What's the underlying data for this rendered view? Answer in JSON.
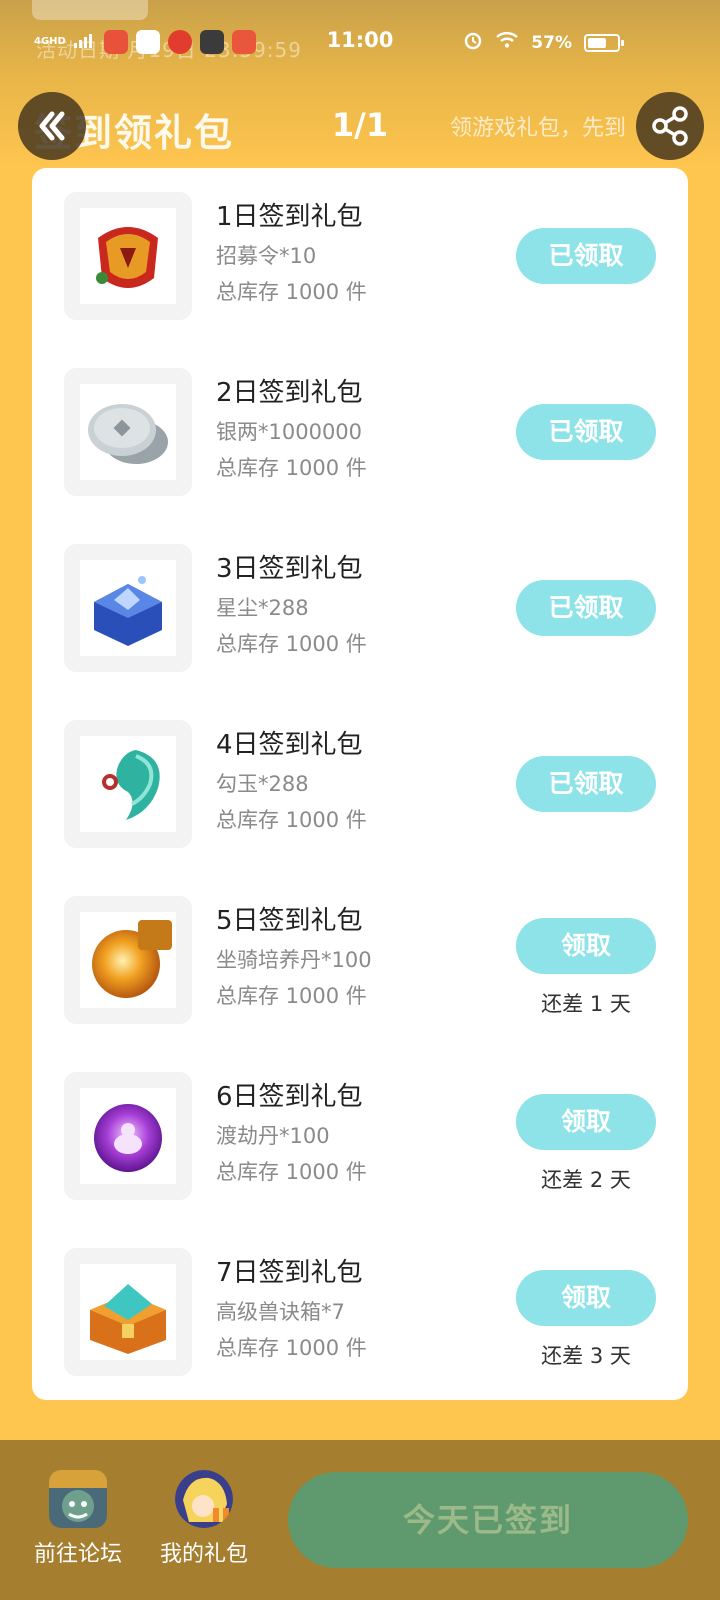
{
  "status_bar": {
    "network": "4GHD",
    "time": "11:00",
    "battery": "57%",
    "faded_text": "活动日期 月19日 23:59:59"
  },
  "header": {
    "title": "签到领礼包",
    "pager": "1/1",
    "hint": "领游戏礼包，先到",
    "back_icon": "chevron-double-left",
    "share_icon": "share"
  },
  "gifts": [
    {
      "title": "1日签到礼包",
      "desc": "招募令*10",
      "stock": "总库存 1000 件",
      "button": "已领取",
      "remain": "",
      "icon": "recruit-token-icon"
    },
    {
      "title": "2日签到礼包",
      "desc": "银两*1000000",
      "stock": "总库存 1000 件",
      "button": "已领取",
      "remain": "",
      "icon": "silver-coins-icon"
    },
    {
      "title": "3日签到礼包",
      "desc": "星尘*288",
      "stock": "总库存 1000 件",
      "button": "已领取",
      "remain": "",
      "icon": "stardust-chest-icon"
    },
    {
      "title": "4日签到礼包",
      "desc": "勾玉*288",
      "stock": "总库存 1000 件",
      "button": "已领取",
      "remain": "",
      "icon": "magatama-icon"
    },
    {
      "title": "5日签到礼包",
      "desc": "坐骑培养丹*100",
      "stock": "总库存 1000 件",
      "button": "领取",
      "remain": "还差 1 天",
      "icon": "mount-pill-icon"
    },
    {
      "title": "6日签到礼包",
      "desc": "渡劫丹*100",
      "stock": "总库存 1000 件",
      "button": "领取",
      "remain": "还差 2 天",
      "icon": "tribulation-pill-icon"
    },
    {
      "title": "7日签到礼包",
      "desc": "高级兽诀箱*7",
      "stock": "总库存 1000 件",
      "button": "领取",
      "remain": "还差 3 天",
      "icon": "beast-chest-icon"
    }
  ],
  "bottom": {
    "forum_label": "前往论坛",
    "gifts_label": "我的礼包",
    "signed_label": "今天已签到"
  },
  "colors": {
    "background": "#FFC64F",
    "button": "#8EE3E8",
    "bottom_bar": "#A67E2F",
    "signed_button": "#5F9A6E"
  }
}
